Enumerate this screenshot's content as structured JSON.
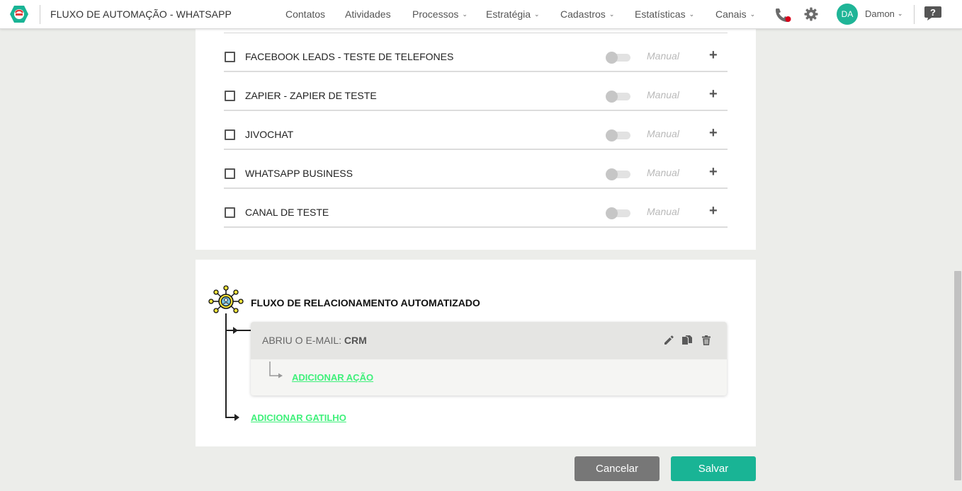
{
  "header": {
    "title": "FLUXO DE AUTOMAÇÃO - WHATSAPP",
    "nav": [
      {
        "label": "Contatos",
        "dropdown": false
      },
      {
        "label": "Atividades",
        "dropdown": false
      },
      {
        "label": "Processos",
        "dropdown": true
      },
      {
        "label": "Estratégia",
        "dropdown": true
      },
      {
        "label": "Cadastros",
        "dropdown": true
      },
      {
        "label": "Estatísticas",
        "dropdown": true
      },
      {
        "label": "Canais",
        "dropdown": true
      }
    ],
    "avatar_initials": "DA",
    "user_name": "Damon"
  },
  "channels": [
    {
      "name": "FACEBOOK LEADS - TESTE DE TELEFONES",
      "mode": "Manual",
      "enabled": false,
      "checked": false
    },
    {
      "name": "ZAPIER - ZAPIER DE TESTE",
      "mode": "Manual",
      "enabled": false,
      "checked": false
    },
    {
      "name": "JIVOCHAT",
      "mode": "Manual",
      "enabled": false,
      "checked": false
    },
    {
      "name": "WHATSAPP BUSINESS",
      "mode": "Manual",
      "enabled": false,
      "checked": false
    },
    {
      "name": "CANAL DE TESTE",
      "mode": "Manual",
      "enabled": false,
      "checked": false
    }
  ],
  "flow": {
    "title": "FLUXO DE RELACIONAMENTO AUTOMATIZADO",
    "trigger": {
      "label": "ABRIU O E-MAIL:",
      "value": "CRM"
    },
    "add_action": "ADICIONAR AÇÃO",
    "add_trigger": "ADICIONAR GATILHO"
  },
  "footer": {
    "cancel": "Cancelar",
    "save": "Salvar"
  },
  "colors": {
    "brand": "#19b495",
    "link_green": "#3ff07a",
    "phone_dot": "#d8001a",
    "cancel_gray": "#777777"
  },
  "icons": {
    "logo": "logo-icon",
    "phone": "phone-icon",
    "settings": "gear-icon",
    "help": "help-icon",
    "edit": "pencil-icon",
    "copy": "copy-icon",
    "delete": "trash-icon",
    "add": "plus-icon",
    "flow": "flow-network-icon"
  }
}
